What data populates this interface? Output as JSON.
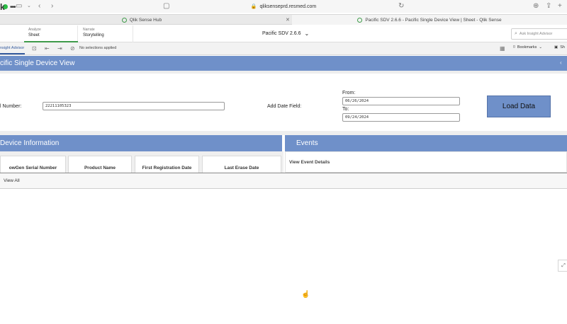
{
  "browser": {
    "url": "qliksenseprd.resmed.com",
    "tabs": [
      {
        "label": "Qlik Sense Hub"
      },
      {
        "label": "Pacific SDV 2.6.6 - Pacific Single Device View | Sheet - Qlik Sense"
      }
    ]
  },
  "header": {
    "logo_text": "k",
    "menu_glyph": "•••",
    "nav": [
      {
        "small": "Analyze",
        "big": "Sheet"
      },
      {
        "small": "Narrate",
        "big": "Storytelling"
      }
    ],
    "app_title": "Pacific SDV 2.6.6",
    "search_placeholder": "Ask Insight Advisor"
  },
  "toolbar": {
    "insight_advisor": "nsight Advisor",
    "no_selections": "No selections applied",
    "bookmarks": "Bookmarks",
    "share": "Sh"
  },
  "banner": {
    "title": "cific Single Device View"
  },
  "form": {
    "serial_label": "l Number:",
    "serial_value": "22211105323",
    "date_field_label": "Add Date Field:",
    "from_label": "From:",
    "from_value": "06/26/2024",
    "to_label": "To:",
    "to_value": "09/24/2024",
    "load_button": "Load Data"
  },
  "device_info": {
    "title": "Device Information",
    "columns": [
      "owGen Serial Number",
      "Product Name",
      "First Registration Date",
      "Last Erase Date"
    ]
  },
  "events": {
    "title": "Events",
    "link": "View Event Details"
  },
  "view_all": "View All",
  "colors": {
    "accent_blue": "#6f90c9",
    "qlik_green": "#3f9b4a"
  }
}
